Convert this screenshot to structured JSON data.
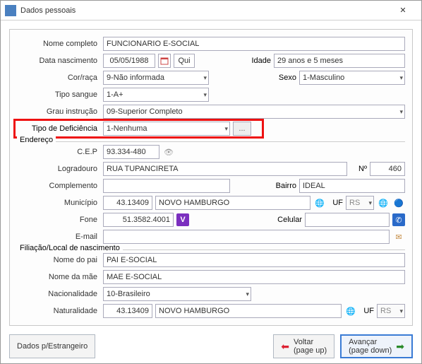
{
  "window": {
    "title": "Dados pessoais"
  },
  "topform": {
    "nome_completo_label": "Nome completo",
    "nome_completo": "FUNCIONARIO E-SOCIAL",
    "data_nasc_label": "Data nascimento",
    "data_nasc": "05/05/1988",
    "data_nasc_day": "Qui",
    "idade_label": "Idade",
    "idade": "29 anos e 5 meses",
    "corraca_label": "Cor/raça",
    "corraca": "9-Não informada",
    "sexo_label": "Sexo",
    "sexo": "1-Masculino",
    "tiposangue_label": "Tipo sangue",
    "tiposangue": "1-A+",
    "grau_label": "Grau instrução",
    "grau": "09-Superior Completo",
    "deficiencia_label": "Tipo de Deficiência",
    "deficiencia": "1-Nenhuma",
    "deficiencia_btn": "..."
  },
  "endereco": {
    "legend": "Endereço",
    "cep_label": "C.E.P",
    "cep": "93.334-480",
    "logradouro_label": "Logradouro",
    "logradouro": "RUA TUPANCIRETA",
    "numero_label": "Nº",
    "numero": "460",
    "complemento_label": "Complemento",
    "complemento": "",
    "bairro_label": "Bairro",
    "bairro": "IDEAL",
    "municipio_label": "Município",
    "municipio_cod": "43.13409",
    "municipio_nome": "NOVO HAMBURGO",
    "uf_label": "UF",
    "uf": "RS",
    "fone_label": "Fone",
    "fone": "51.3582.4001",
    "celular_label": "Celular",
    "celular": "",
    "email_label": "E-mail",
    "email": ""
  },
  "filiacao": {
    "legend": "Filiação/Local de nascimento",
    "pai_label": "Nome do pai",
    "pai": "PAI E-SOCIAL",
    "mae_label": "Nome da mãe",
    "mae": "MAE E-SOCIAL",
    "nacionalidade_label": "Nacionalidade",
    "nacionalidade": "10-Brasileiro",
    "naturalidade_label": "Naturalidade",
    "naturalidade_cod": "43.13409",
    "naturalidade_nome": "NOVO HAMBURGO",
    "uf_label": "UF",
    "uf": "RS"
  },
  "footer": {
    "estrangeiro": "Dados p/Estrangeiro",
    "voltar_l1": "Voltar",
    "voltar_l2": "(page up)",
    "avancar_l1": "Avançar",
    "avancar_l2": "(page down)"
  }
}
